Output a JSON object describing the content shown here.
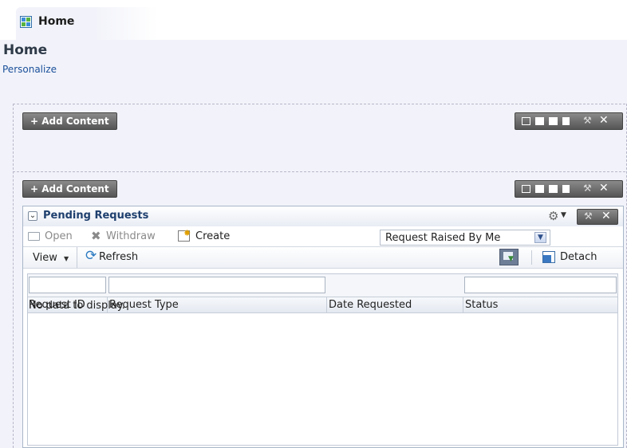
{
  "tab": {
    "label": "Home"
  },
  "page": {
    "title": "Home",
    "personalize_link": "Personalize"
  },
  "layout_zones": [
    {
      "add_content_label": "+ Add Content"
    },
    {
      "add_content_label": "+ Add Content"
    }
  ],
  "panel": {
    "title": "Pending Requests",
    "toolbar": {
      "open_label": "Open",
      "withdraw_label": "Withdraw",
      "create_label": "Create",
      "filter_select_value": "Request Raised By Me"
    },
    "view_bar": {
      "view_label": "View",
      "refresh_label": "Refresh",
      "detach_label": "Detach"
    },
    "table": {
      "columns": [
        "Request ID",
        "Request Type",
        "Date Requested",
        "Status"
      ],
      "empty_message": "No data to display."
    }
  },
  "colors": {
    "link": "#1a4f9a",
    "panel_title": "#1e3f6e",
    "background": "#f2f3fa",
    "toolbar_dark": "#555555"
  },
  "icons": {
    "tab": "grid-icon",
    "open": "folder-icon",
    "withdraw": "withdraw-icon",
    "create": "create-icon",
    "refresh": "refresh-icon",
    "detach": "detach-icon",
    "filter": "query-filter-icon",
    "settings": "gear-icon"
  }
}
